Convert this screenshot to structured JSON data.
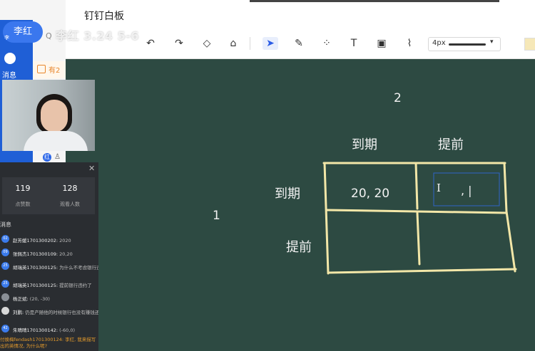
{
  "window": {
    "title": "钉钉白板"
  },
  "sidebar": {
    "user_name": "李红",
    "user_small": "李",
    "ghost_text": "李红 3.24 5-6",
    "q_text": "Q",
    "msg_label": "消息",
    "notice_text": "有2",
    "tag_letter": "红"
  },
  "toolbar": {
    "stroke_width": "4px",
    "tools": [
      "undo-icon",
      "redo-icon",
      "eraser-icon",
      "clear-icon",
      "select-icon",
      "pen-icon",
      "shapes-icon",
      "text-icon",
      "image-icon",
      "brush-icon"
    ]
  },
  "stats": {
    "likes_value": "119",
    "likes_label": "点赞数",
    "viewers_value": "128",
    "viewers_label": "观看人数"
  },
  "chat": {
    "section_title": "消息",
    "messages": [
      {
        "badge": "02",
        "name": "赵芳媛1701300202:",
        "text": "2020"
      },
      {
        "badge": "09",
        "name": "张佩杰1701300109:",
        "text": "20,20"
      },
      {
        "badge": "25",
        "name": "胡瑞英1701300125:",
        "text": "为什么不考虑银行违约呢?"
      },
      {
        "badge": "25",
        "name": "胡瑞英1701300125:",
        "text": "提前银行违约了"
      },
      {
        "badge": "",
        "name": "杨正斌:",
        "text": "(20, -30)"
      },
      {
        "badge": "",
        "name": "刘鹏:",
        "text": "仍是产随他的时候银行也没有赚钱还。"
      },
      {
        "badge": "42",
        "name": "朱晴晴1701300142:",
        "text": "(-60,0)"
      }
    ],
    "warning": "付焕梅fendash1701300124: 李红, 我来描写出的英情况, 为什么呢?"
  },
  "board": {
    "num_top": "2",
    "num_left": "1",
    "col_header_1": "到期",
    "col_header_2": "提前",
    "row_header_1": "到期",
    "row_header_2": "提前",
    "cell_1": "20, 20",
    "cell_2": ", |",
    "cursor": "I"
  },
  "colors": {
    "board_bg": "#2d4a42",
    "accent_blue": "#2b66e8",
    "chalk": "#f2f2f2",
    "chalk_yellow": "#f3e7a8"
  }
}
